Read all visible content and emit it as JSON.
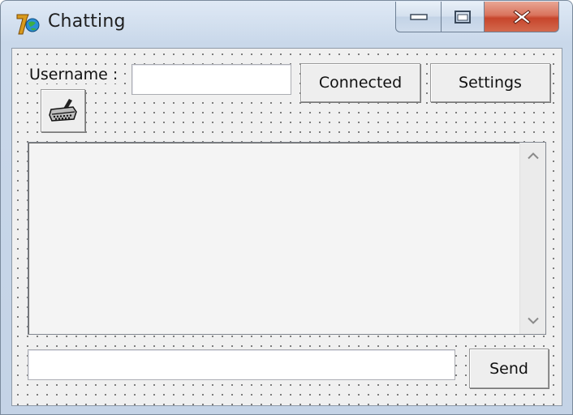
{
  "window": {
    "title": "Chatting"
  },
  "form": {
    "username_label": "Username :",
    "username_value": "",
    "connect_label": "Connected",
    "settings_label": "Settings",
    "send_label": "Send",
    "message_value": "",
    "chat_text": ""
  },
  "colors": {
    "close_button": "#c7452c",
    "titlebar": "#c9d8ea",
    "form_background": "#f0f0f0"
  },
  "icons": {
    "app": "app-logo-icon",
    "plug": "serial-plug-icon",
    "minimize": "minimize-icon",
    "maximize": "maximize-icon",
    "close": "close-icon",
    "scroll_up": "scroll-up-arrow-icon",
    "scroll_down": "scroll-down-arrow-icon"
  }
}
